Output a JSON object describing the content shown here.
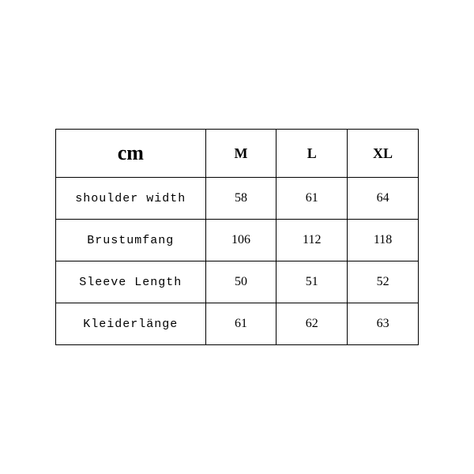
{
  "chart_data": {
    "type": "table",
    "unit_header": "cm",
    "columns": [
      "M",
      "L",
      "XL"
    ],
    "rows": [
      {
        "label": "shoulder width",
        "values": [
          58,
          61,
          64
        ]
      },
      {
        "label": "Brustumfang",
        "values": [
          106,
          112,
          118
        ]
      },
      {
        "label": "Sleeve Length",
        "values": [
          50,
          51,
          52
        ]
      },
      {
        "label": "Kleiderlänge",
        "values": [
          61,
          62,
          63
        ]
      }
    ]
  }
}
